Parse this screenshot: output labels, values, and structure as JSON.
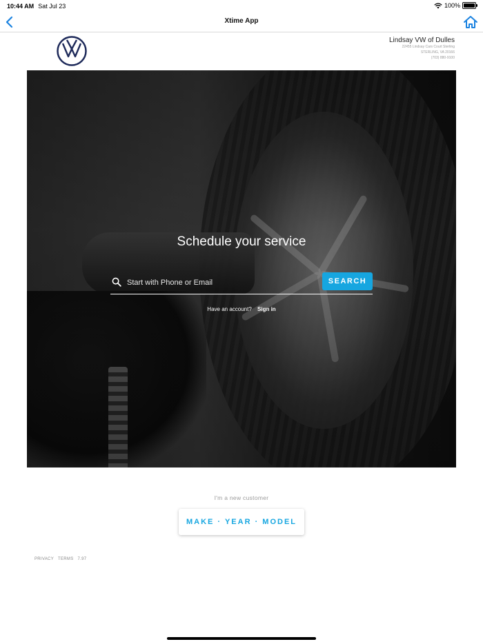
{
  "status_bar": {
    "time": "10:44 AM",
    "date": "Sat Jul 23",
    "battery": "100%"
  },
  "nav": {
    "title": "Xtime App",
    "back_icon": "chevron-left-icon",
    "home_icon": "home-icon"
  },
  "dealer": {
    "name": "Lindsay VW of Dulles",
    "address1": "22455 Lindsay Cars Court Sterling",
    "address2": "STERLING, VA 20166",
    "phone": "(703) 880-9100"
  },
  "hero": {
    "title": "Schedule your service",
    "search_placeholder": "Start with Phone or Email",
    "search_button": "SEARCH",
    "account_prompt": "Have an account?",
    "sign_in": "Sign in"
  },
  "new_customer": {
    "label": "I'm a new customer",
    "button": "MAKE · YEAR · MODEL"
  },
  "footer": {
    "privacy": "PRIVACY",
    "terms": "TERMS",
    "version": "7.97"
  },
  "colors": {
    "accent": "#16a6e0",
    "ios_blue": "#1a82e0",
    "vw_navy": "#1e2a5a"
  }
}
